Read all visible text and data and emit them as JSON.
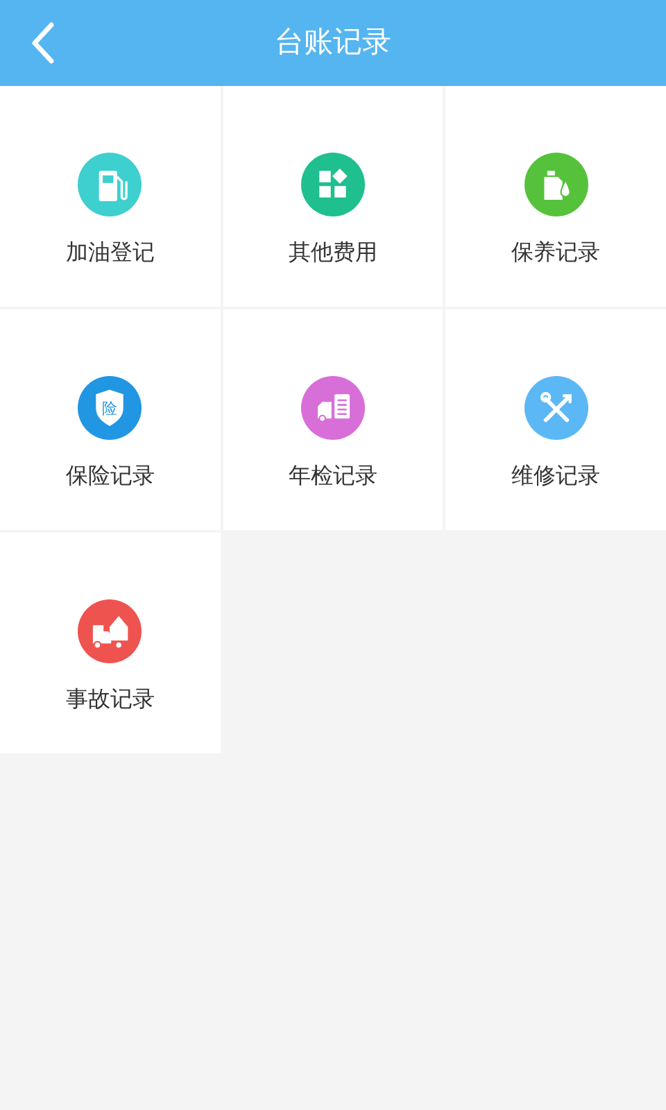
{
  "header": {
    "title": "台账记录"
  },
  "items": [
    {
      "label": "加油登记",
      "kind": "fuel",
      "color": "#3ecfcf"
    },
    {
      "label": "其他费用",
      "kind": "apps",
      "color": "#1fbf8f"
    },
    {
      "label": "保养记录",
      "kind": "oil",
      "color": "#56c23c"
    },
    {
      "label": "保险记录",
      "kind": "shield",
      "color": "#2196e3",
      "badge": "险"
    },
    {
      "label": "年检记录",
      "kind": "inspection",
      "color": "#d86fd8"
    },
    {
      "label": "维修记录",
      "kind": "tools",
      "color": "#5bb8f5"
    },
    {
      "label": "事故记录",
      "kind": "accident",
      "color": "#ef5350"
    }
  ]
}
